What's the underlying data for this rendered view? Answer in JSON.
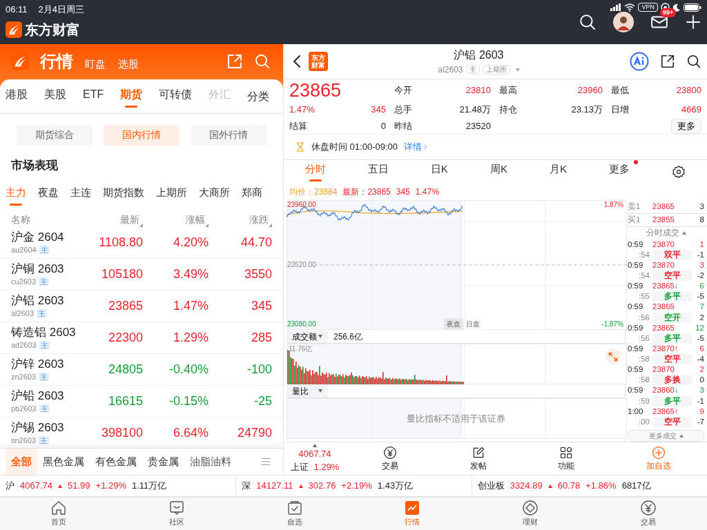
{
  "status_bar": {
    "time": "06:11",
    "date": "2月4日周三",
    "vpn": "VPN"
  },
  "app_bar": {
    "brand": "东方财富",
    "mail_badge": "99+"
  },
  "left": {
    "header": {
      "title": "行情",
      "links": [
        "盯盘",
        "选股"
      ]
    },
    "tabs": [
      {
        "label": "港股",
        "selected": false
      },
      {
        "label": "美股",
        "selected": false
      },
      {
        "label": "ETF",
        "selected": false
      },
      {
        "label": "期货",
        "selected": true
      },
      {
        "label": "可转债",
        "selected": false
      },
      {
        "label": "外汇",
        "selected": false
      }
    ],
    "category_label": "分类",
    "segments": [
      {
        "label": "期货综合",
        "selected": false
      },
      {
        "label": "国内行情",
        "selected": true
      },
      {
        "label": "国外行情",
        "selected": false
      }
    ],
    "section_title": "市场表现",
    "exchange_tabs": [
      {
        "label": "主力",
        "selected": true
      },
      {
        "label": "夜盘",
        "selected": false
      },
      {
        "label": "主连",
        "selected": false
      },
      {
        "label": "期货指数",
        "selected": false
      },
      {
        "label": "上期所",
        "selected": false
      },
      {
        "label": "大商所",
        "selected": false
      },
      {
        "label": "郑商",
        "selected": false
      }
    ],
    "columns": [
      "名称",
      "最新",
      "涨幅",
      "涨跌"
    ],
    "rows": [
      {
        "name": "沪金 2604",
        "code": "au2604",
        "tag": "主",
        "last": "1108.80",
        "pct": "4.20%",
        "change": "44.70",
        "color": "#e8232b"
      },
      {
        "name": "沪铜 2603",
        "code": "cu2603",
        "tag": "主",
        "last": "105180",
        "pct": "3.49%",
        "change": "3550",
        "color": "#e8232b"
      },
      {
        "name": "沪铝 2603",
        "code": "al2603",
        "tag": "主",
        "last": "23865",
        "pct": "1.47%",
        "change": "345",
        "color": "#e8232b"
      },
      {
        "name": "铸造铝 2603",
        "code": "ad2603",
        "tag": "主",
        "last": "22300",
        "pct": "1.29%",
        "change": "285",
        "color": "#e8232b"
      },
      {
        "name": "沪锌 2603",
        "code": "zn2603",
        "tag": "主",
        "last": "24805",
        "pct": "-0.40%",
        "change": "-100",
        "color": "#13a035"
      },
      {
        "name": "沪铅 2603",
        "code": "pb2603",
        "tag": "主",
        "last": "16615",
        "pct": "-0.15%",
        "change": "-25",
        "color": "#13a035"
      },
      {
        "name": "沪锡 2603",
        "code": "sn2603",
        "tag": "主",
        "last": "398100",
        "pct": "6.64%",
        "change": "24790",
        "color": "#e8232b"
      }
    ],
    "categories": [
      {
        "label": "全部",
        "selected": true
      },
      {
        "label": "黑色金属",
        "selected": false
      },
      {
        "label": "有色金属",
        "selected": false
      },
      {
        "label": "贵金属",
        "selected": false
      },
      {
        "label": "油脂油料",
        "selected": false
      }
    ]
  },
  "right": {
    "header": {
      "badge": [
        "东方",
        "财富"
      ],
      "title": "沪铝 2603",
      "code": "al2603",
      "tags": [
        "主",
        "上期所"
      ]
    },
    "quote": {
      "price": "23865",
      "pct": "1.47%",
      "change": "345",
      "settle_label": "结算",
      "settle": "0",
      "stats": [
        {
          "label": "今开",
          "value": "23810",
          "color": "#e8232b"
        },
        {
          "label": "最高",
          "value": "23960",
          "color": "#e8232b"
        },
        {
          "label": "最低",
          "value": "23800",
          "color": "#e8232b"
        },
        {
          "label": "总手",
          "value": "21.48万",
          "color": "#222222"
        },
        {
          "label": "持仓",
          "value": "23.13万",
          "color": "#222222"
        },
        {
          "label": "日增",
          "value": "4669",
          "color": "#e8232b"
        },
        {
          "label": "昨结",
          "value": "23520",
          "color": "#222222"
        }
      ],
      "more": "更多"
    },
    "notice": {
      "text": "休盘时间 01:00-09:00",
      "link": "详情"
    },
    "chart_tabs": [
      {
        "label": "分时",
        "selected": true
      },
      {
        "label": "五日",
        "selected": false
      },
      {
        "label": "日K",
        "selected": false
      },
      {
        "label": "周K",
        "selected": false
      },
      {
        "label": "月K",
        "selected": false
      },
      {
        "label": "更多",
        "selected": false
      }
    ],
    "info": {
      "avg_label": "均价：",
      "avg": "23884",
      "last_label": "最新：",
      "last": "23865",
      "change": "345",
      "pct": "1.47%"
    },
    "chart": {
      "y_high": "23960.00",
      "y_mid": "23520.00",
      "y_low": "23080.00",
      "pct_high": "1.87%",
      "pct_low": "-1.87%",
      "sessions": [
        {
          "label": "夜盘",
          "selected": true
        },
        {
          "label": "日盘",
          "selected": false
        }
      ]
    },
    "volume": {
      "selector": "成交额",
      "total": "256.6亿",
      "max": "11.76亿"
    },
    "ratio": {
      "selector": "量比",
      "message": "量比指标不适用于该证券"
    },
    "order_book": [
      {
        "label": "卖1",
        "price": "23865",
        "qty": "3"
      },
      {
        "label": "买1",
        "price": "23855",
        "qty": "8"
      }
    ],
    "ticks": {
      "title": "分时成交",
      "more": "更多成交",
      "rows": [
        {
          "time": "0:59",
          "sec": ":54",
          "price": "23870",
          "arrow": "",
          "color": "#e8232b",
          "qty": "1",
          "action": "双平",
          "net": "-1"
        },
        {
          "time": "0:59",
          "sec": ":54",
          "price": "23870",
          "arrow": "",
          "color": "#e8232b",
          "qty": "3",
          "action": "空平",
          "net": "-2"
        },
        {
          "time": "0:59",
          "sec": ":55",
          "price": "23865",
          "arrow": "↓",
          "color": "#13a035",
          "qty": "6",
          "action": "多平",
          "net": "-5"
        },
        {
          "time": "0:59",
          "sec": ":56",
          "price": "23865",
          "arrow": "",
          "color": "#13a035",
          "qty": "7",
          "action": "空开",
          "net": "2"
        },
        {
          "time": "0:59",
          "sec": ":56",
          "price": "23865",
          "arrow": "",
          "color": "#13a035",
          "qty": "12",
          "action": "多平",
          "net": "-5"
        },
        {
          "time": "0:59",
          "sec": ":58",
          "price": "23870",
          "arrow": "↑",
          "color": "#e8232b",
          "qty": "6",
          "action": "空平",
          "net": "-4"
        },
        {
          "time": "0:59",
          "sec": ":58",
          "price": "23870",
          "arrow": "",
          "color": "#e8232b",
          "qty": "2",
          "action": "多换",
          "net": "0"
        },
        {
          "time": "0:59",
          "sec": ":59",
          "price": "23860",
          "arrow": "↓",
          "color": "#13a035",
          "qty": "3",
          "action": "多平",
          "net": "-1"
        },
        {
          "time": "1:00",
          "sec": ":00",
          "price": "23865",
          "arrow": "↑",
          "color": "#e8232b",
          "qty": "9",
          "action": "空平",
          "net": "-7"
        }
      ]
    },
    "action_bar": {
      "index": {
        "value": "4067.74",
        "name": "上证",
        "pct": "1.29%"
      },
      "buttons": [
        {
          "label": "交易",
          "highlighted": false
        },
        {
          "label": "发帖",
          "highlighted": false
        },
        {
          "label": "功能",
          "highlighted": false
        },
        {
          "label": "加自选",
          "highlighted": true
        }
      ]
    }
  },
  "index_ticker": [
    {
      "name": "沪",
      "value": "4067.74",
      "change": "51.99",
      "pct": "+1.29%",
      "amount": "1.11万亿",
      "color": "#e8232b"
    },
    {
      "name": "深",
      "value": "14127.11",
      "change": "302.76",
      "pct": "+2.19%",
      "amount": "1.43万亿",
      "color": "#e8232b"
    },
    {
      "name": "创业板",
      "value": "3324.89",
      "change": "60.78",
      "pct": "+1.86%",
      "amount": "6817亿",
      "color": "#e8232b"
    }
  ],
  "bottom_nav": [
    {
      "label": "首页",
      "selected": false
    },
    {
      "label": "社区",
      "selected": false
    },
    {
      "label": "自选",
      "selected": false
    },
    {
      "label": "行情",
      "selected": true
    },
    {
      "label": "理财",
      "selected": false
    },
    {
      "label": "交易",
      "selected": false
    }
  ]
}
